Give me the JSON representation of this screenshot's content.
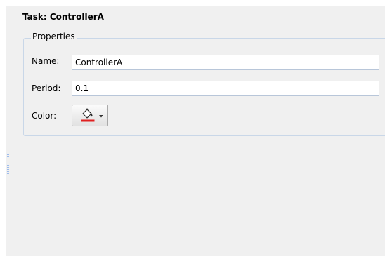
{
  "task": {
    "title": "Task: ControllerA"
  },
  "properties": {
    "legend": "Properties",
    "name_label": "Name:",
    "name_value": "ControllerA",
    "period_label": "Period:",
    "period_value": "0.1",
    "color_label": "Color:",
    "color_value": "#e02020",
    "color_icon": "paint-bucket-icon"
  }
}
